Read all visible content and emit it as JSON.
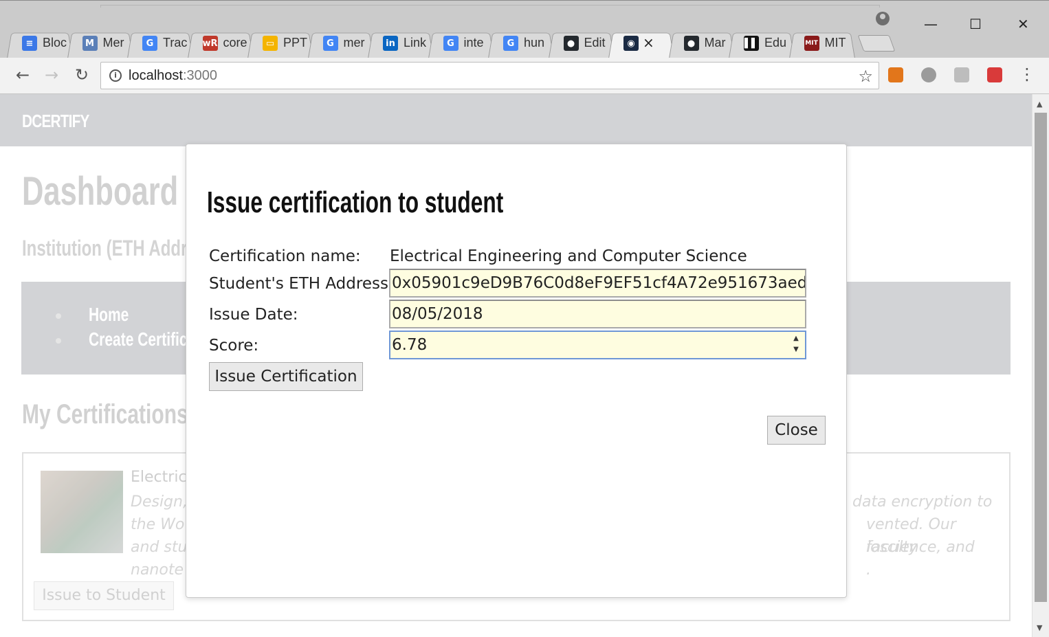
{
  "browser": {
    "tabs": [
      {
        "label": "Bloc",
        "icon": "blogger-icon",
        "color": "#3b78e7",
        "glyph": "≡"
      },
      {
        "label": "Mer",
        "icon": "mymplus-icon",
        "color": "#5a7fb8",
        "glyph": "M"
      },
      {
        "label": "Trac",
        "icon": "google-translate-icon",
        "color": "#4285f4",
        "glyph": "G"
      },
      {
        "label": "core",
        "icon": "wordreference-icon",
        "color": "#c0392b",
        "glyph": "wR"
      },
      {
        "label": "PPT",
        "icon": "google-slides-icon",
        "color": "#f4b400",
        "glyph": "▭"
      },
      {
        "label": "mer",
        "icon": "google-icon",
        "color": "#4285f4",
        "glyph": "G"
      },
      {
        "label": "Link",
        "icon": "linkedin-icon",
        "color": "#0a66c2",
        "glyph": "in"
      },
      {
        "label": "inte",
        "icon": "google-icon",
        "color": "#4285f4",
        "glyph": "G"
      },
      {
        "label": "hun",
        "icon": "google-icon",
        "color": "#4285f4",
        "glyph": "G"
      },
      {
        "label": "Edit",
        "icon": "github-icon",
        "color": "#24292e",
        "glyph": "●"
      },
      {
        "label": "",
        "icon": "app-icon",
        "color": "#1b2b44",
        "glyph": "◉",
        "active": true
      },
      {
        "label": "Mar",
        "icon": "github-icon",
        "color": "#24292e",
        "glyph": "●"
      },
      {
        "label": "Edu",
        "icon": "edx-icon",
        "color": "#111111",
        "glyph": "▌▌"
      },
      {
        "label": "MIT",
        "icon": "mit-icon",
        "color": "#8a1a1a",
        "glyph": "MIT"
      }
    ],
    "close_tab_glyph": "×",
    "window_controls": {
      "minimize": "—",
      "maximize": "☐",
      "close": "✕"
    },
    "url_host": "localhost",
    "url_port": ":3000",
    "extensions": [
      {
        "name": "metamask-icon",
        "color": "#e2761b"
      },
      {
        "name": "circle-extension-icon",
        "color": "#9b9b9b"
      },
      {
        "name": "cast-icon",
        "color": "#bdbdbd"
      },
      {
        "name": "react-devtools-icon",
        "color": "#d93a3a"
      }
    ]
  },
  "page": {
    "brand": "DCERTIFY",
    "dashboard_title": "Dashboard",
    "institution_title": "Institution (ETH Addre",
    "menu": [
      "Home",
      "Create Certificatio"
    ],
    "my_certifications_title": "My Certifications",
    "certification": {
      "name": "Electric",
      "description_lines": [
        {
          "left": "Design,",
          "right": "data encryption to"
        },
        {
          "left": "the Wo",
          "right": "vented. Our faculty"
        },
        {
          "left": "and stu",
          "right": "ioscience, and"
        },
        {
          "left": "nanote",
          "right": "."
        }
      ],
      "issue_button": "Issue to Student"
    }
  },
  "modal": {
    "title": "Issue certification to student",
    "fields": {
      "certification_name_label": "Certification name:",
      "certification_name_value": "Electrical Engineering and Computer Science",
      "eth_address_label": "Student's ETH Address:",
      "eth_address_value": "0x05901c9eD9B76C0d8eF9EF51cf4A72e951673aed",
      "issue_date_label": "Issue Date:",
      "issue_date_value": "08/05/2018",
      "score_label": "Score:",
      "score_value": "6.78"
    },
    "submit_button": "Issue Certification",
    "close_button": "Close"
  }
}
